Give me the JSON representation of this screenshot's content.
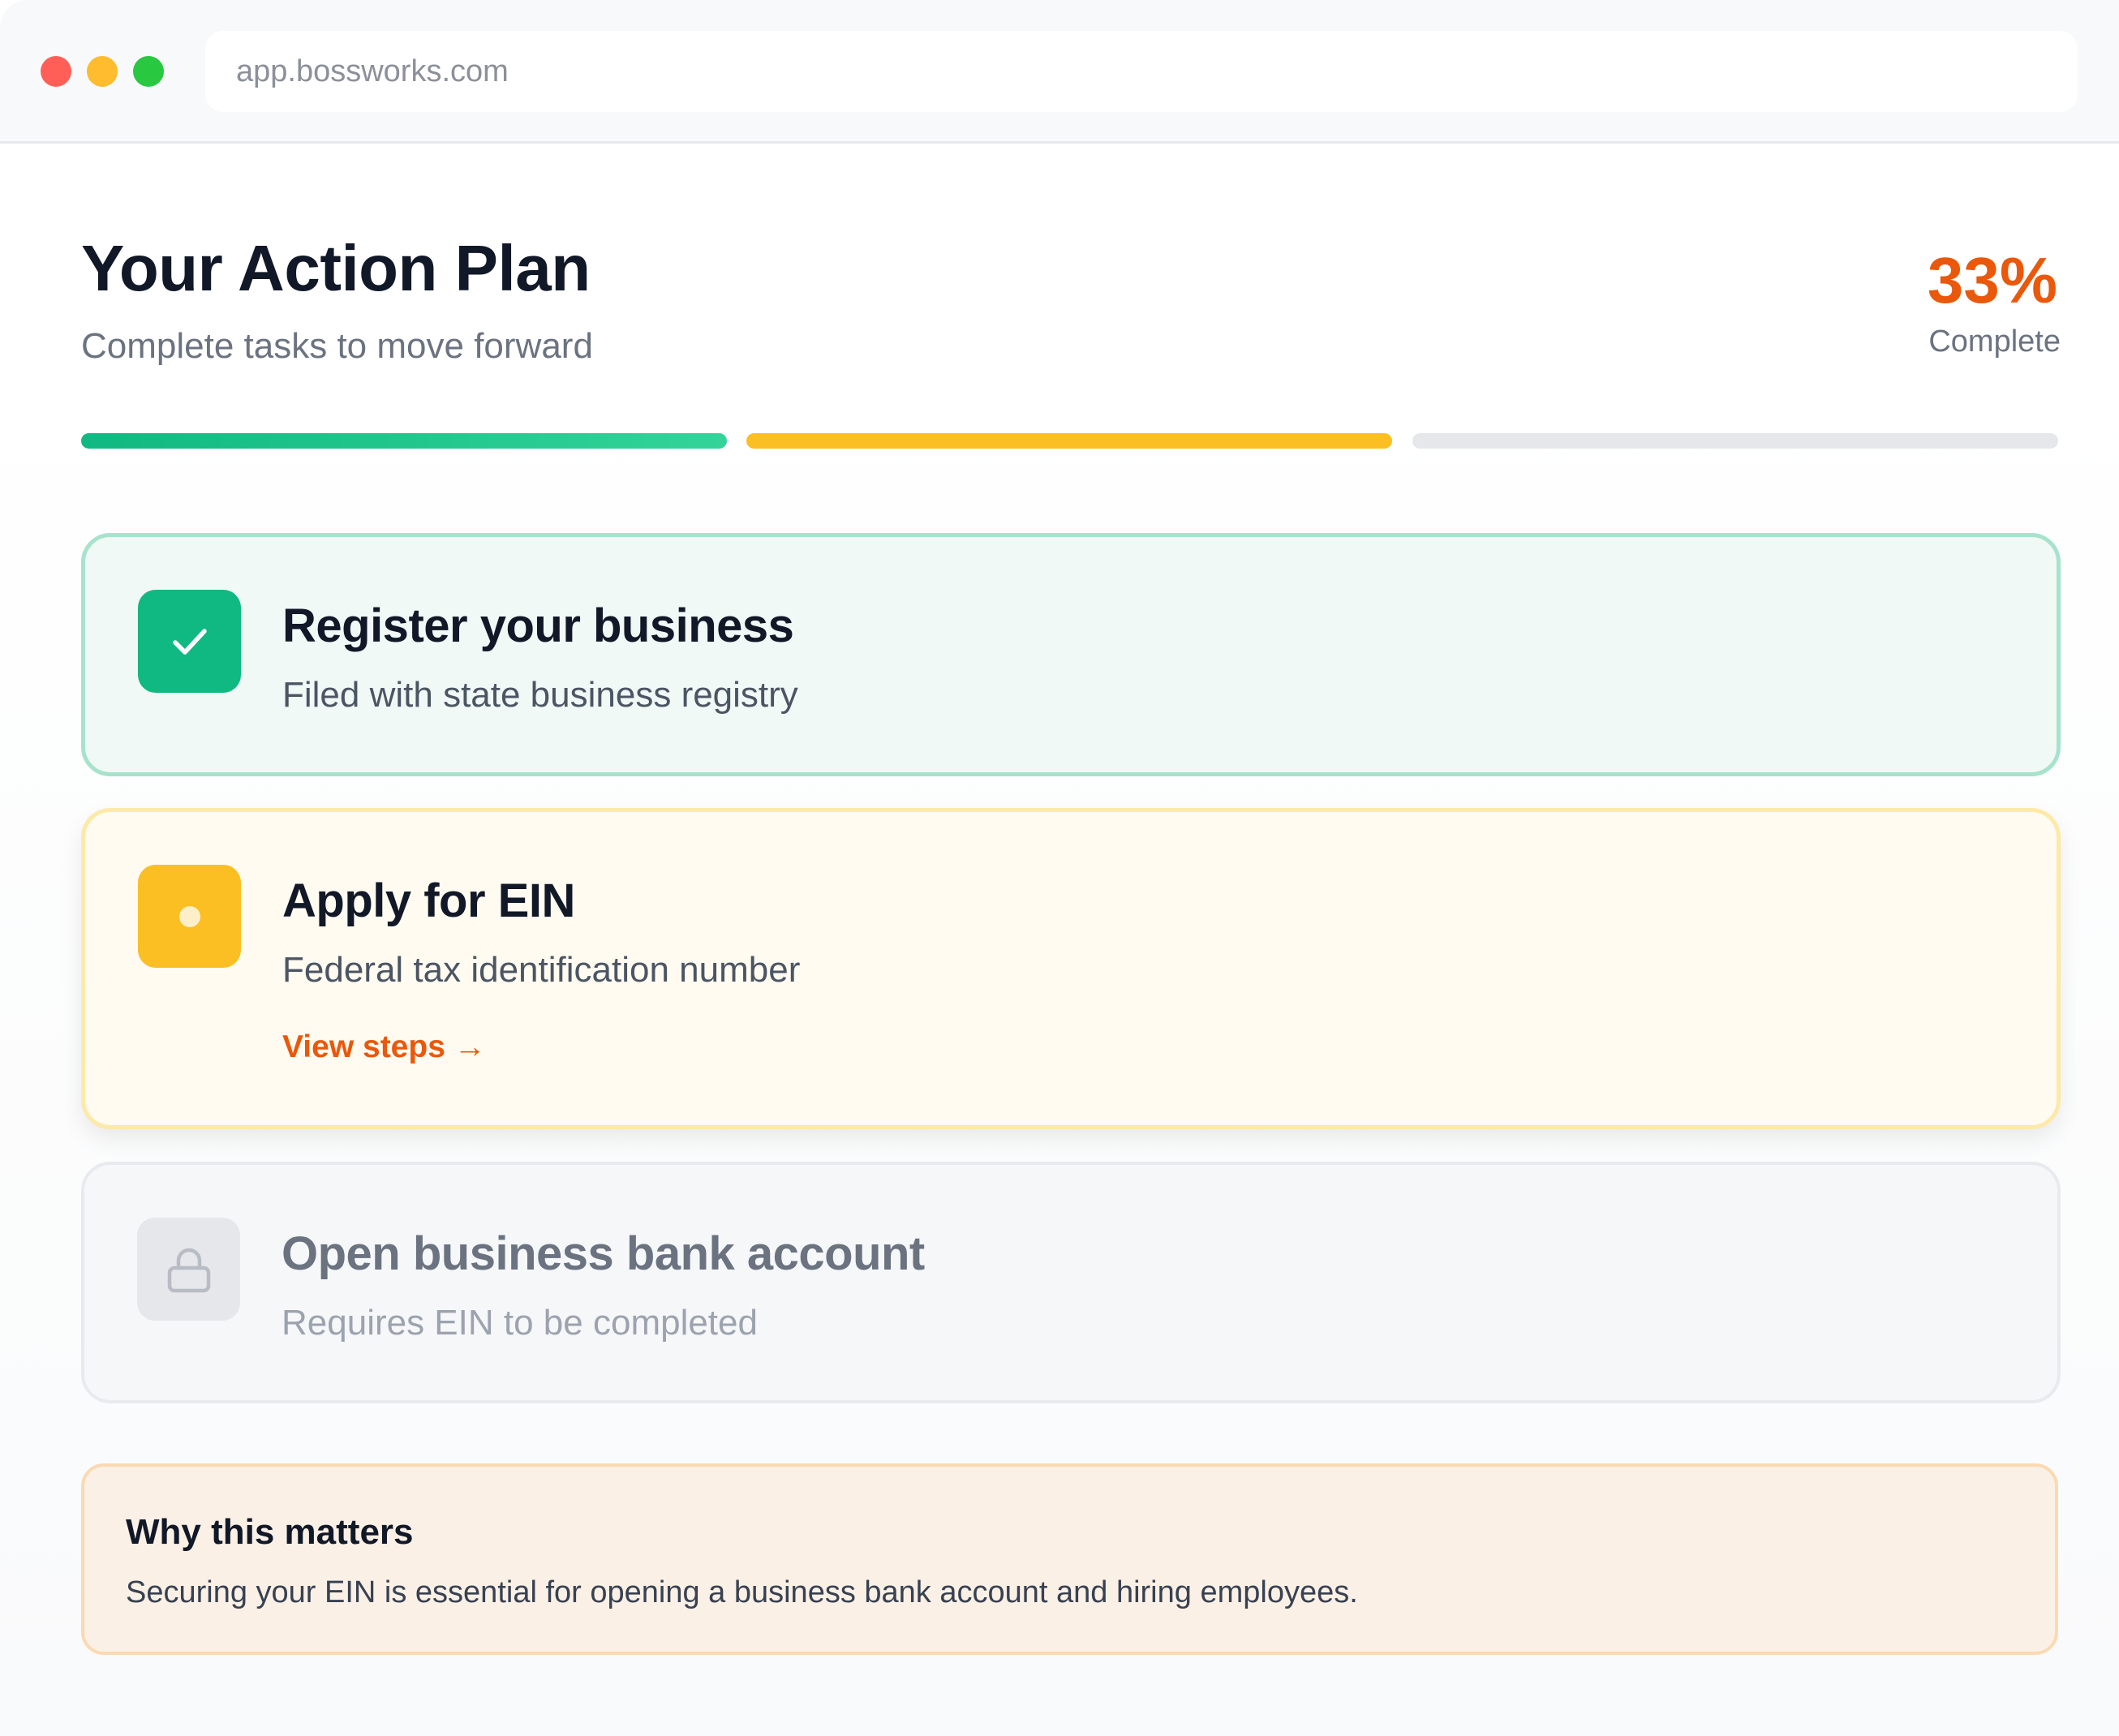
{
  "browser": {
    "url": "app.bossworks.com"
  },
  "header": {
    "title": "Your Action Plan",
    "subtitle": "Complete tasks to move forward",
    "progress_value": "33%",
    "progress_label": "Complete"
  },
  "progress_segments": [
    {
      "status": "completed",
      "color": "#10b981"
    },
    {
      "status": "in-progress",
      "color": "#fbbf24"
    },
    {
      "status": "locked",
      "color": "#e5e7eb"
    }
  ],
  "tasks": [
    {
      "title": "Register your business",
      "description": "Filed with state business registry",
      "status": "completed",
      "icon": "checkmark-icon"
    },
    {
      "title": "Apply for EIN",
      "description": "Federal tax identification number",
      "status": "in-progress",
      "icon": "dot-icon",
      "link": "View steps →"
    },
    {
      "title": "Open business bank account",
      "description": "Requires EIN to be completed",
      "status": "locked",
      "icon": "lock-icon"
    }
  ],
  "info": {
    "title": "Why this matters",
    "body": "Securing your EIN is essential for opening a business bank account and hiring employees."
  },
  "colors": {
    "accent": "#ea580c",
    "success": "#10b981",
    "warning": "#fbbf24",
    "muted": "#e5e7eb"
  }
}
